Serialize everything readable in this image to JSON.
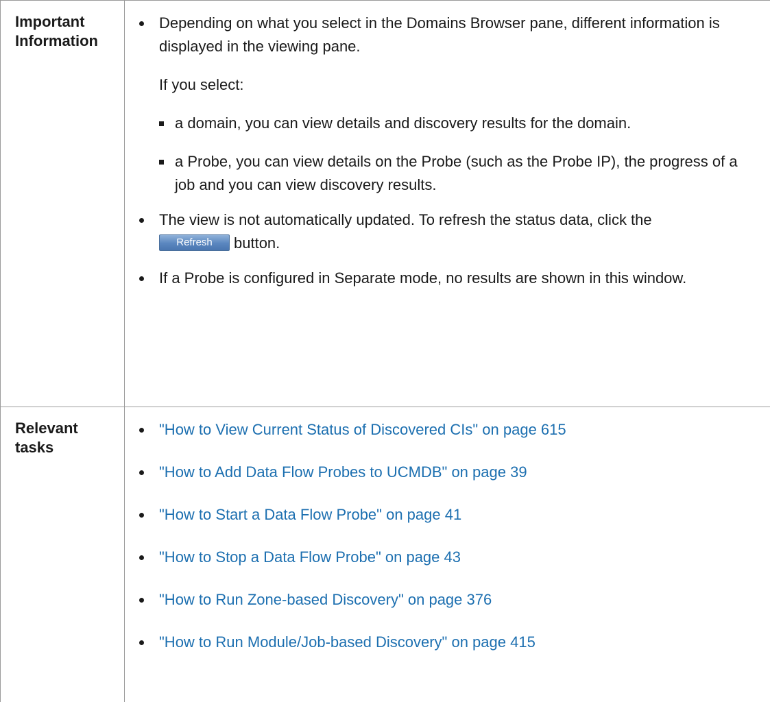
{
  "important": {
    "label": "Important Information",
    "bullet1": "Depending on what you select in the Domains Browser pane, different information is displayed in the viewing pane.",
    "if_select": "If you select:",
    "sub1": "a domain, you can view details and discovery results for the domain.",
    "sub2": "a Probe, you can view details on the Probe (such as the Probe IP), the progress of a job and you can view discovery results.",
    "bullet2": "The view is not automatically updated. To refresh the status data, click the",
    "refresh_label": "Refresh",
    "bullet2_tail": "button.",
    "bullet3": "If a Probe is configured in Separate mode, no results are shown in this window."
  },
  "relevant": {
    "label": "Relevant tasks",
    "links": [
      "\"How to View Current Status of Discovered CIs\" on page 615",
      "\"How to Add Data Flow Probes to UCMDB\" on page 39",
      "\"How to Start a Data Flow Probe\" on page 41",
      "\"How to Stop a Data Flow Probe\" on page 43",
      "\"How to Run Zone-based Discovery\" on page 376",
      "\"How to Run Module/Job-based Discovery\" on page 415"
    ]
  },
  "colors": {
    "link": "#1c6fb0",
    "border": "#9a9a9a",
    "button": "#5a86bf"
  }
}
